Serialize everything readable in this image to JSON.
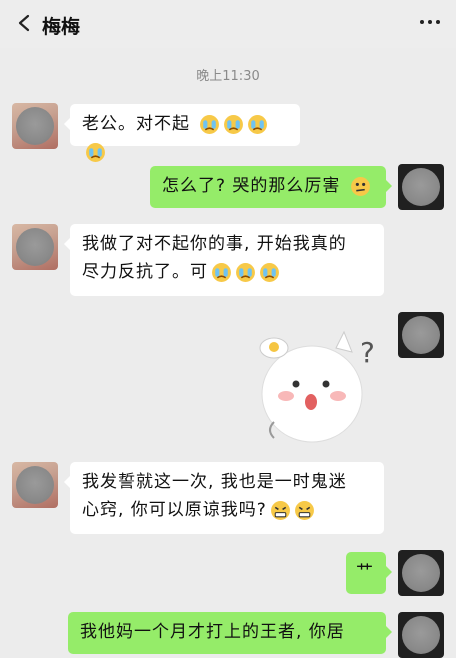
{
  "header": {
    "contact_name": "梅梅",
    "back_icon": "chevron-left-icon",
    "more_icon": "ellipsis-icon"
  },
  "timestamp": "晚上11:30",
  "messages": [
    {
      "side": "left",
      "text": "老公。对不起",
      "emoji": [
        "crying-face",
        "crying-face",
        "crying-face",
        "crying-face"
      ]
    },
    {
      "side": "right",
      "text": "怎么了? 哭的那么厉害",
      "emoji": [
        "puzzled-face"
      ]
    },
    {
      "side": "left",
      "text_line1": "我做了对不起你的事, 开始我真的",
      "text_line2": "尽力反抗了。可",
      "emoji": [
        "crying-face",
        "crying-face",
        "crying-face"
      ]
    },
    {
      "side": "right",
      "type": "sticker",
      "sticker": "confused-cat-sticker",
      "sticker_text": "?"
    },
    {
      "side": "left",
      "text_line1": "我发誓就这一次, 我也是一时鬼迷",
      "text_line2": "心窍, 你可以原谅我吗?",
      "emoji": [
        "grimace-face",
        "grimace-face"
      ]
    },
    {
      "side": "right",
      "text": "艹"
    },
    {
      "side": "right",
      "text": "我他妈一个月才打上的王者, 你居"
    }
  ],
  "colors": {
    "background": "#ececec",
    "bubble_sent": "#95ec69",
    "bubble_received": "#ffffff",
    "timestamp": "#8a8a8a"
  }
}
